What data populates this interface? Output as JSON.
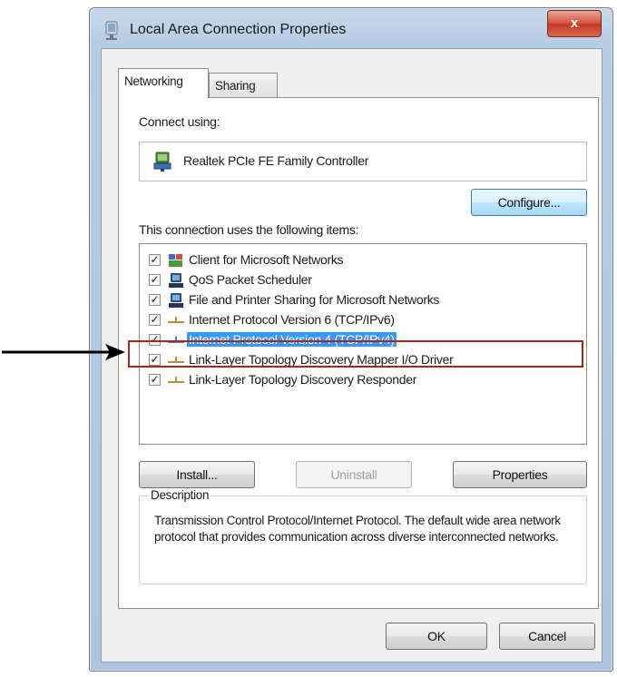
{
  "window": {
    "title": "Local Area Connection Properties",
    "close_label": "x"
  },
  "tabs": [
    {
      "label": "Networking",
      "active": true
    },
    {
      "label": "Sharing",
      "active": false
    }
  ],
  "connect_using": {
    "label": "Connect using:",
    "adapter_name": "Realtek PCIe FE Family Controller",
    "configure_label": "Configure..."
  },
  "items_section": {
    "label": "This connection uses the following items:",
    "items": [
      {
        "label": "Client for Microsoft Networks",
        "checked": true,
        "icon": "network-client-icon"
      },
      {
        "label": "QoS Packet Scheduler",
        "checked": true,
        "icon": "qos-scheduler-icon"
      },
      {
        "label": "File and Printer Sharing for Microsoft Networks",
        "checked": true,
        "icon": "file-printer-sharing-icon"
      },
      {
        "label": "Internet Protocol Version 6 (TCP/IPv6)",
        "checked": true,
        "icon": "protocol-icon"
      },
      {
        "label": "Internet Protocol Version 4 (TCP/IPv4)",
        "checked": true,
        "icon": "protocol-icon",
        "selected": true
      },
      {
        "label": "Link-Layer Topology Discovery Mapper I/O Driver",
        "checked": true,
        "icon": "protocol-icon"
      },
      {
        "label": "Link-Layer Topology Discovery Responder",
        "checked": true,
        "icon": "protocol-icon"
      }
    ]
  },
  "actions": {
    "install_label": "Install...",
    "uninstall_label": "Uninstall",
    "properties_label": "Properties"
  },
  "description": {
    "legend": "Description",
    "text": "Transmission Control Protocol/Internet Protocol. The default wide area network protocol that provides communication across diverse interconnected networks."
  },
  "footer": {
    "ok_label": "OK",
    "cancel_label": "Cancel"
  },
  "colors": {
    "selection": "#3399ff",
    "highlight_border": "#b0221a",
    "arrow": "#000000"
  }
}
